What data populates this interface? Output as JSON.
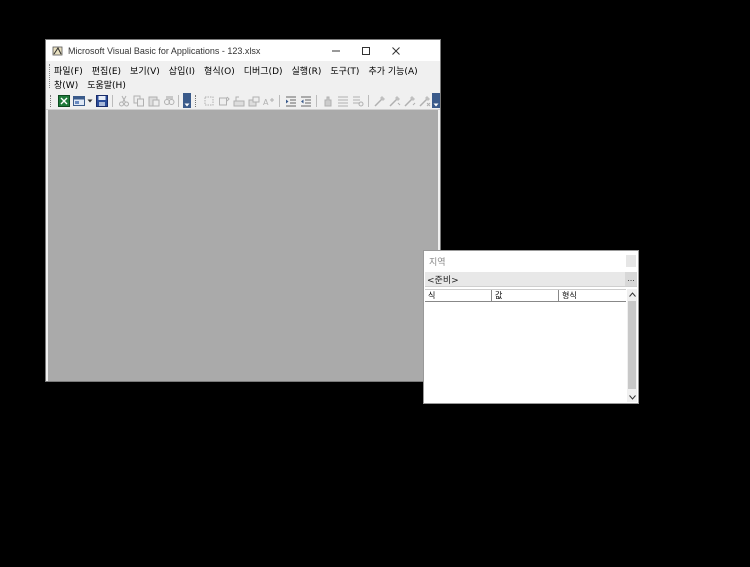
{
  "window": {
    "title": "Microsoft Visual Basic for Applications - 123.xlsx"
  },
  "menu": {
    "row1": [
      "파일(F)",
      "편집(E)",
      "보기(V)",
      "삽입(I)",
      "형식(O)",
      "디버그(D)",
      "실행(R)",
      "도구(T)",
      "추가 기능(A)"
    ],
    "row2": [
      "창(W)",
      "도움말(H)"
    ]
  },
  "locals": {
    "title": "지역",
    "context": "<준비>",
    "context_button": "...",
    "columns": [
      "식",
      "값",
      "형식"
    ]
  },
  "colors": {
    "workspace": "#aaaaaa",
    "desktop": "#000000",
    "toolbar_overflow": "#3a5a8a"
  },
  "icons": {
    "app": "vba-app-icon",
    "excel": "excel-view-icon",
    "insert": "insert-userform-icon",
    "save": "save-icon"
  }
}
